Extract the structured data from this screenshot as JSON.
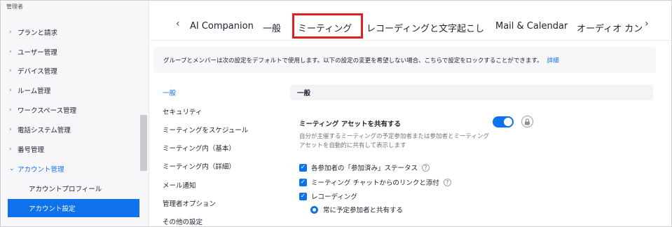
{
  "sidebar": {
    "header": "管理者",
    "items": [
      {
        "label": "プランと請求",
        "chevron": "›"
      },
      {
        "label": "ユーザー管理",
        "chevron": "›"
      },
      {
        "label": "デバイス管理",
        "chevron": "›"
      },
      {
        "label": "ルーム管理",
        "chevron": "›"
      },
      {
        "label": "ワークスペース管理",
        "chevron": "›"
      },
      {
        "label": "電話システム管理",
        "chevron": "›"
      },
      {
        "label": "番号管理",
        "chevron": "›"
      },
      {
        "label": "アカウント管理",
        "chevron": "⌄"
      }
    ],
    "subitems": [
      {
        "label": "アカウントプロフィール"
      },
      {
        "label": "アカウント設定"
      }
    ]
  },
  "tabs": {
    "prev": "‹",
    "next": "›",
    "items": [
      {
        "label": "AI Companion"
      },
      {
        "label": "一般"
      },
      {
        "label": "ミーティング"
      },
      {
        "label": "レコーディングと文字起こし"
      },
      {
        "label": "Mail & Calendar"
      },
      {
        "label": "オーディオ カン"
      }
    ],
    "active_index": 2
  },
  "banner": {
    "text": "グループとメンバーは次の設定をデフォルトで使用します。以下の設定の変更を希望しない場合、こちらで設定をロックすることができます。",
    "link": "詳細"
  },
  "subnav": [
    {
      "label": "一般"
    },
    {
      "label": "セキュリティ"
    },
    {
      "label": "ミーティングをスケジュール"
    },
    {
      "label": "ミーティング内（基本）"
    },
    {
      "label": "ミーティング内（詳細）"
    },
    {
      "label": "メール通知"
    },
    {
      "label": "管理者オプション"
    },
    {
      "label": "その他の設定"
    }
  ],
  "section": {
    "title": "一般"
  },
  "setting": {
    "title": "ミーティング アセットを共有する",
    "description": "自分が主催するミーティングの予定参加者または参加者とミーティング アセットを自動的に共有して表示します",
    "enabled": true
  },
  "checkboxes": [
    {
      "label": "各参加者の「参加済み」ステータス",
      "help": "?"
    },
    {
      "label": "ミーティング チャットからのリンクと添付",
      "help": "?"
    },
    {
      "label": "レコーディング",
      "help": ""
    }
  ],
  "radio": {
    "label": "常に予定参加者と共有する"
  },
  "colors": {
    "accent": "#0e72ed",
    "highlight": "#e02020"
  }
}
